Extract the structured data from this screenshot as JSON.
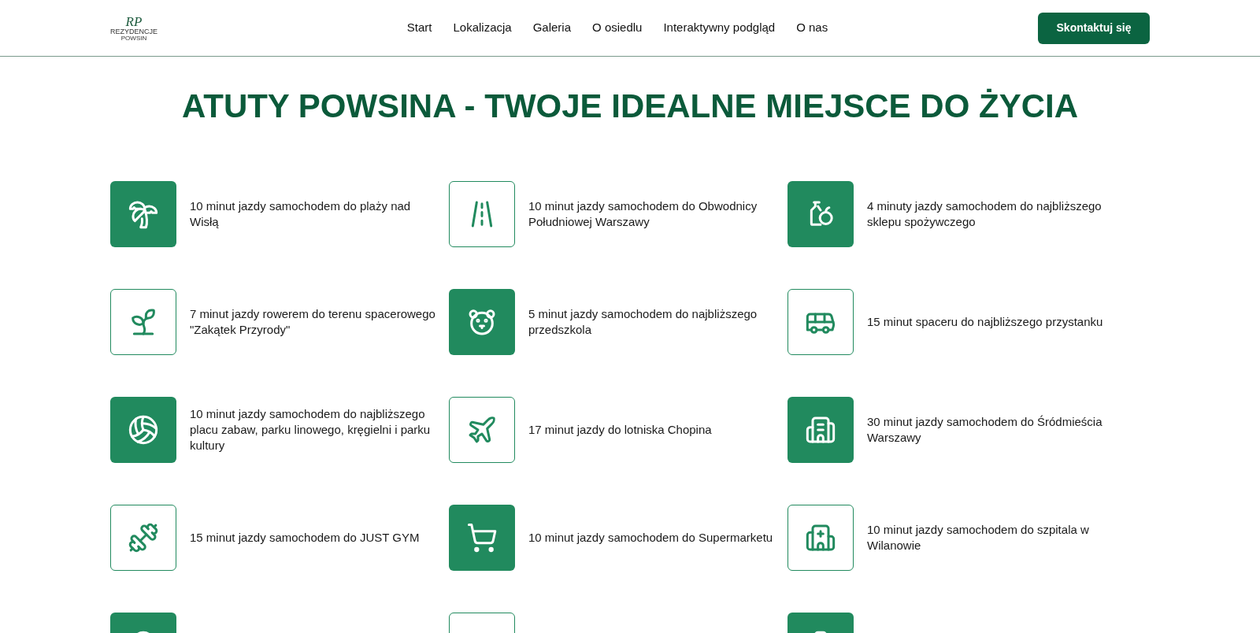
{
  "header": {
    "logo": {
      "monogram": "RP",
      "name": "REZYDENCJE",
      "place": "POWSIN"
    },
    "nav": [
      {
        "label": "Start"
      },
      {
        "label": "Lokalizacja"
      },
      {
        "label": "Galeria"
      },
      {
        "label": "O osiedlu"
      },
      {
        "label": "Interaktywny podgląd"
      },
      {
        "label": "O nas"
      }
    ],
    "cta": "Skontaktuj się"
  },
  "heading": "ATUTY POWSINA - TWOJE IDEALNE MIEJSCE DO ŻYCIA",
  "features": [
    {
      "text": "10 minut jazdy samochodem do plaży nad Wisłą",
      "filled": true
    },
    {
      "text": "10 minut jazdy samochodem do Obwodnicy Południowej Warszawy",
      "filled": false
    },
    {
      "text": "4 minuty jazdy samochodem do najbliższego sklepu spożywczego",
      "filled": true
    },
    {
      "text": "7 minut jazdy rowerem do terenu spacerowego \"Zakątek Przyrody\"",
      "filled": false
    },
    {
      "text": "5 minut jazdy samochodem do najbliższego przedszkola",
      "filled": true
    },
    {
      "text": "15 minut spaceru do najbliższego przystanku",
      "filled": false
    },
    {
      "text": "10 minut jazdy samochodem do najbliższego placu zabaw, parku linowego, kręgielni i parku kultury",
      "filled": true
    },
    {
      "text": "17 minut jazdy do lotniska Chopina",
      "filled": false
    },
    {
      "text": "30 minut jazdy samochodem do Śródmieścia Warszawy",
      "filled": true
    },
    {
      "text": "15 minut jazdy samochodem do JUST GYM",
      "filled": false
    },
    {
      "text": "10 minut jazdy samochodem do Supermarketu",
      "filled": true
    },
    {
      "text": "10 minut jazdy samochodem do szpitala w Wilanowie",
      "filled": false
    }
  ],
  "cut_tiles": [
    {
      "filled": true
    },
    {
      "filled": false
    },
    {
      "filled": true
    }
  ]
}
